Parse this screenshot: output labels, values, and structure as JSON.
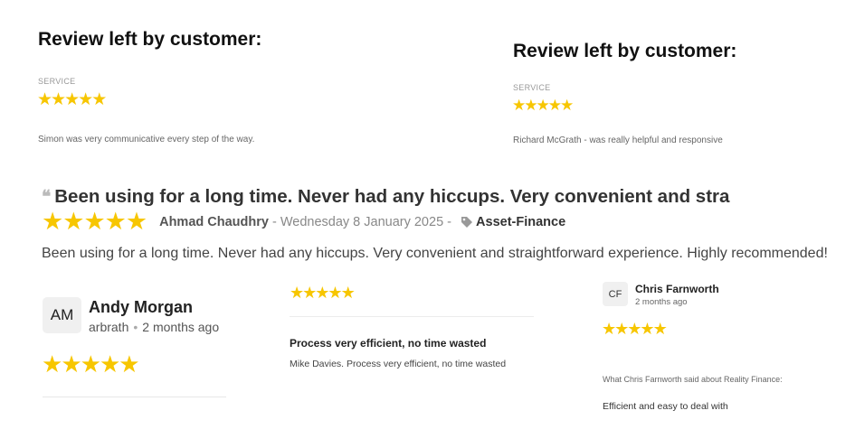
{
  "accent_color": "#f7c600",
  "review_1": {
    "title": "Review left by customer:",
    "label": "SERVICE",
    "rating": 5,
    "text": "Simon was very communicative every step of the way."
  },
  "review_2": {
    "title": "Review left by customer:",
    "label": "SERVICE",
    "rating": 5,
    "text": "Richard McGrath - was really helpful and responsive"
  },
  "review_3": {
    "quote_icon": "quote-icon",
    "headline": "Been using for a long time. Never had any hiccups. Very convenient and stra",
    "rating": 5,
    "author": "Ahmad Chaudhry",
    "separator": " - ",
    "date": "Wednesday 8 January 2025",
    "tag_icon": "tag-icon",
    "category": "Asset-Finance",
    "body": "Been using for a long time. Never had any hiccups. Very convenient and straightforward experience. Highly recommended!"
  },
  "review_andy": {
    "initials": "AM",
    "name": "Andy Morgan",
    "location": "arbrath",
    "dot": "•",
    "time": "2 months ago",
    "rating": 5
  },
  "review_mike": {
    "rating": 5,
    "title": "Process very efficient, no time wasted",
    "text": "Mike Davies. Process very efficient, no time wasted"
  },
  "review_chris": {
    "initials": "CF",
    "name": "Chris Farnworth",
    "time": "2 months ago",
    "rating": 5,
    "label": "What Chris Farnworth said about Reality Finance:",
    "text": "Efficient and easy to deal with"
  }
}
